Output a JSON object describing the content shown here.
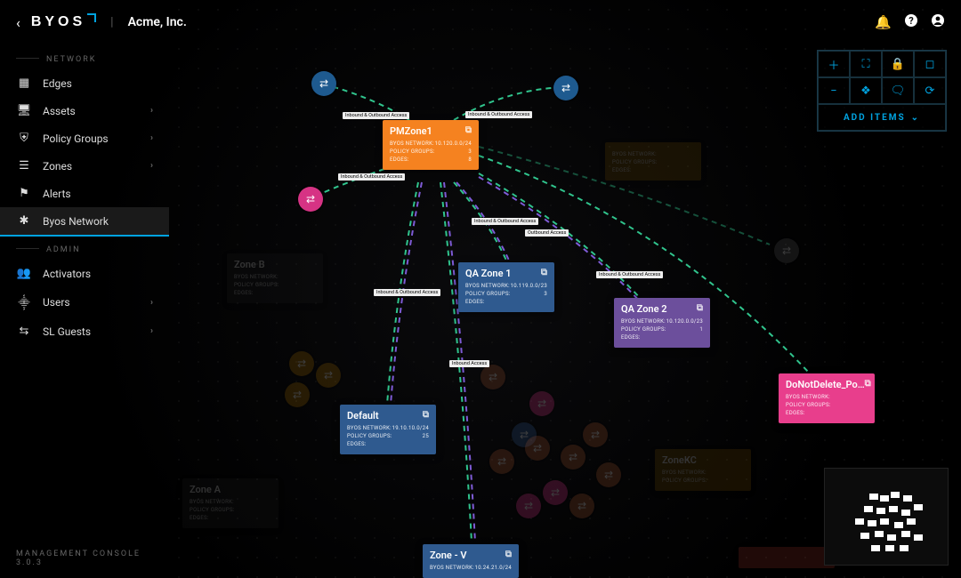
{
  "header": {
    "logo_text": "BYOS",
    "tenant": "Acme, Inc."
  },
  "sidebar": {
    "sections": [
      {
        "label": "NETWORK",
        "items": [
          {
            "icon": "edges",
            "label": "Edges",
            "expandable": false
          },
          {
            "icon": "assets",
            "label": "Assets",
            "expandable": true
          },
          {
            "icon": "policy",
            "label": "Policy Groups",
            "expandable": true
          },
          {
            "icon": "zones",
            "label": "Zones",
            "expandable": true
          },
          {
            "icon": "alerts",
            "label": "Alerts",
            "expandable": false
          },
          {
            "icon": "network",
            "label": "Byos Network",
            "expandable": false,
            "active": true
          }
        ]
      },
      {
        "label": "ADMIN",
        "items": [
          {
            "icon": "activators",
            "label": "Activators",
            "expandable": false
          },
          {
            "icon": "users",
            "label": "Users",
            "expandable": true
          },
          {
            "icon": "guests",
            "label": "SL Guests",
            "expandable": true
          }
        ]
      }
    ]
  },
  "toolbar": {
    "add_items_label": "ADD ITEMS"
  },
  "zones": {
    "pm": {
      "name": "PMZone1",
      "network": "10.120.0.0/24",
      "policy_groups": "3",
      "edges": "8",
      "color": "#F58220"
    },
    "qa1": {
      "name": "QA Zone 1",
      "network": "10.119.0.0/23",
      "policy_groups": "3",
      "edges": "",
      "color": "#2F5A8F"
    },
    "qa2": {
      "name": "QA Zone 2",
      "network": "10.120.0.0/23",
      "policy_groups": "1",
      "edges": "",
      "color": "#6C4F9C"
    },
    "default": {
      "name": "Default",
      "network": "19.10.10.0/24",
      "policy_groups": "25",
      "edges": "",
      "color": "#2F5A8F"
    },
    "donot": {
      "name": "DoNotDelete_Po…",
      "network": "",
      "policy_groups": "",
      "edges": "",
      "color": "#E83E8C"
    },
    "zonev": {
      "name": "Zone - V",
      "network": "10.24.21.0/24",
      "policy_groups": "",
      "edges": "",
      "color": "#2F5A8F"
    },
    "dim_a": {
      "name": "Zone A",
      "color": "#333333"
    },
    "dim_b": {
      "name": "Zone B",
      "color": "#333333"
    },
    "dim_c": {
      "name": "",
      "color": "#A06A00"
    },
    "dim_d": {
      "name": "ZoneKC",
      "color": "#A06A00"
    }
  },
  "edge_labels": {
    "io": "Inbound & Outbound Access",
    "out": "Outbound Access",
    "in": "Inbound Access"
  },
  "footer": {
    "version": "MANAGEMENT CONSOLE 3.0.3"
  }
}
